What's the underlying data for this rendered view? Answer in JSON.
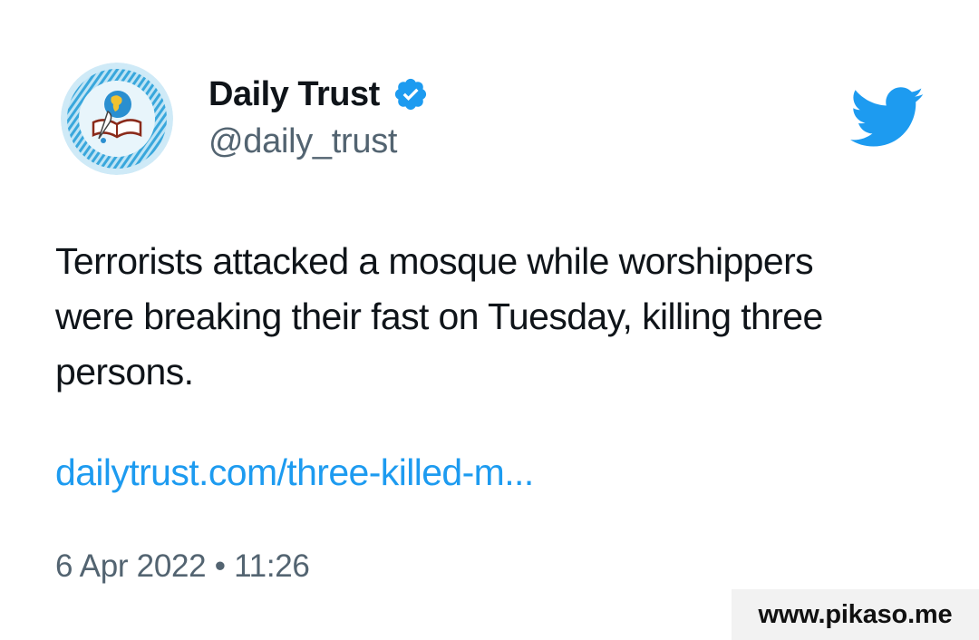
{
  "tweet": {
    "author": {
      "display_name": "Daily Trust",
      "handle": "@daily_trust",
      "verified": true,
      "avatar_icon": "daily-trust-logo-icon"
    },
    "text": "Terrorists attacked a mosque while worshippers\nwere breaking their fast on Tuesday, killing three\npersons.",
    "link_text": "dailytrust.com/three-killed-m...",
    "timestamp": "6 Apr 2022 • 11:26"
  },
  "watermark": {
    "text": "www.pikaso.me"
  },
  "icons": {
    "verified": "verified-badge-icon",
    "platform": "twitter-bird-icon"
  },
  "colors": {
    "link": "#1d9bf0",
    "secondary_text": "#536471",
    "primary_text": "#0f1419",
    "verified": "#1d9bf0",
    "twitter_brand": "#1d9bf0"
  }
}
